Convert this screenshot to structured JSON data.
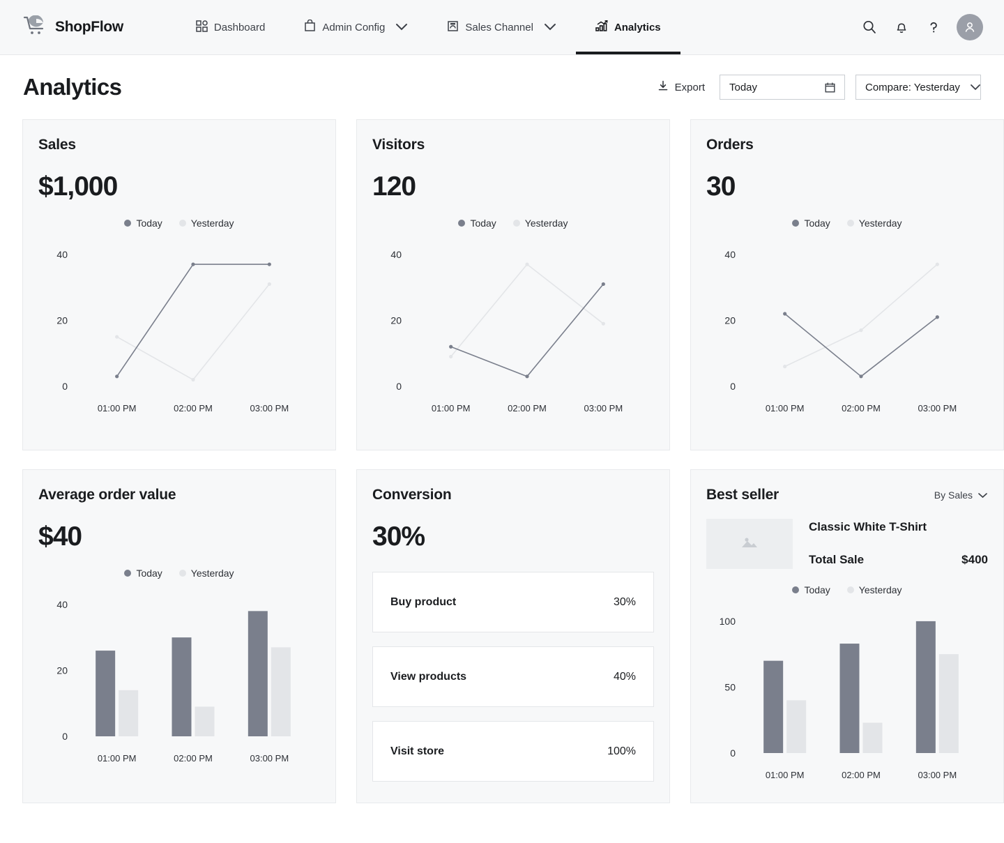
{
  "header": {
    "brand": "ShopFlow",
    "brand_icon": "shopping-cart-icon",
    "nav": [
      {
        "label": "Dashboard",
        "icon": "grid-icon",
        "active": false,
        "caret": false
      },
      {
        "label": "Admin Config",
        "icon": "bag-icon",
        "active": false,
        "caret": true
      },
      {
        "label": "Sales Channel",
        "icon": "store-icon",
        "active": false,
        "caret": true
      },
      {
        "label": "Analytics",
        "icon": "analytics-icon",
        "active": true,
        "caret": false
      }
    ],
    "actions": [
      "search-icon",
      "bell-icon",
      "help-icon",
      "avatar"
    ]
  },
  "page": {
    "title": "Analytics",
    "export_label": "Export",
    "date_value": "Today",
    "date_icon": "calendar-icon",
    "compare_value": "Compare: Yesterday",
    "compare_icon": "chevron-down-icon"
  },
  "legend": {
    "today": "Today",
    "yesterday": "Yesterday"
  },
  "cards": {
    "sales": {
      "title": "Sales",
      "value": "$1,000"
    },
    "visitors": {
      "title": "Visitors",
      "value": "120"
    },
    "orders": {
      "title": "Orders",
      "value": "30"
    },
    "aov": {
      "title": "Average order value",
      "value": "$40"
    },
    "conversion": {
      "title": "Conversion",
      "value": "30%",
      "rows": [
        {
          "label": "Buy product",
          "value": "30%"
        },
        {
          "label": "View products",
          "value": "40%"
        },
        {
          "label": "Visit store",
          "value": "100%"
        }
      ]
    },
    "bestseller": {
      "title": "Best seller",
      "sort_label": "By Sales",
      "product_name": "Classic White T-Shirt",
      "total_sale_label": "Total Sale",
      "total_sale_value": "$400",
      "thumb_icon": "image-placeholder-icon"
    }
  },
  "colors": {
    "today": "#7a7f8c",
    "yesterday": "#e3e5e8",
    "card_bg": "#f7f8f9",
    "card_border": "#e8eaec",
    "text": "#1a1c1f"
  },
  "chart_data": [
    {
      "id": "sales",
      "type": "line",
      "title": "Sales",
      "xlabel": "",
      "ylabel": "",
      "x": [
        "01:00 PM",
        "02:00 PM",
        "03:00 PM"
      ],
      "yticks": [
        0,
        20,
        40
      ],
      "ylim": [
        0,
        44
      ],
      "grid": false,
      "legend": "top",
      "series": [
        {
          "name": "Today",
          "values": [
            3,
            37,
            37
          ],
          "color": "#7a7f8c"
        },
        {
          "name": "Yesterday",
          "values": [
            15,
            2,
            31
          ],
          "color": "#e3e5e8"
        }
      ]
    },
    {
      "id": "visitors",
      "type": "line",
      "title": "Visitors",
      "xlabel": "",
      "ylabel": "",
      "x": [
        "01:00 PM",
        "02:00 PM",
        "03:00 PM"
      ],
      "yticks": [
        0,
        20,
        40
      ],
      "ylim": [
        0,
        44
      ],
      "grid": false,
      "legend": "top",
      "series": [
        {
          "name": "Today",
          "values": [
            12,
            3,
            31
          ],
          "color": "#7a7f8c"
        },
        {
          "name": "Yesterday",
          "values": [
            9,
            37,
            19
          ],
          "color": "#e3e5e8"
        }
      ]
    },
    {
      "id": "orders",
      "type": "line",
      "title": "Orders",
      "xlabel": "",
      "ylabel": "",
      "x": [
        "01:00 PM",
        "02:00 PM",
        "03:00 PM"
      ],
      "yticks": [
        0,
        20,
        40
      ],
      "ylim": [
        0,
        44
      ],
      "grid": false,
      "legend": "top",
      "series": [
        {
          "name": "Today",
          "values": [
            22,
            3,
            21
          ],
          "color": "#7a7f8c"
        },
        {
          "name": "Yesterday",
          "values": [
            6,
            17,
            37
          ],
          "color": "#e3e5e8"
        }
      ]
    },
    {
      "id": "aov",
      "type": "bar",
      "title": "Average order value",
      "xlabel": "",
      "ylabel": "",
      "x": [
        "01:00 PM",
        "02:00 PM",
        "03:00 PM"
      ],
      "yticks": [
        0,
        20,
        40
      ],
      "ylim": [
        0,
        44
      ],
      "grid": false,
      "legend": "top",
      "series": [
        {
          "name": "Today",
          "values": [
            26,
            30,
            38
          ],
          "color": "#7a7f8c"
        },
        {
          "name": "Yesterday",
          "values": [
            14,
            9,
            27
          ],
          "color": "#e3e5e8"
        }
      ]
    },
    {
      "id": "bestseller",
      "type": "bar",
      "title": "Best seller",
      "xlabel": "",
      "ylabel": "",
      "x": [
        "01:00 PM",
        "02:00 PM",
        "03:00 PM"
      ],
      "yticks": [
        0,
        50,
        100
      ],
      "ylim": [
        0,
        110
      ],
      "grid": false,
      "legend": "top",
      "series": [
        {
          "name": "Today",
          "values": [
            70,
            83,
            100
          ],
          "color": "#7a7f8c"
        },
        {
          "name": "Yesterday",
          "values": [
            40,
            23,
            75
          ],
          "color": "#e3e5e8"
        }
      ]
    },
    {
      "id": "conversion-funnel",
      "type": "table",
      "title": "Conversion",
      "categories": [
        "Buy product",
        "View products",
        "Visit store"
      ],
      "values": [
        30,
        40,
        100
      ],
      "unit": "%"
    }
  ]
}
